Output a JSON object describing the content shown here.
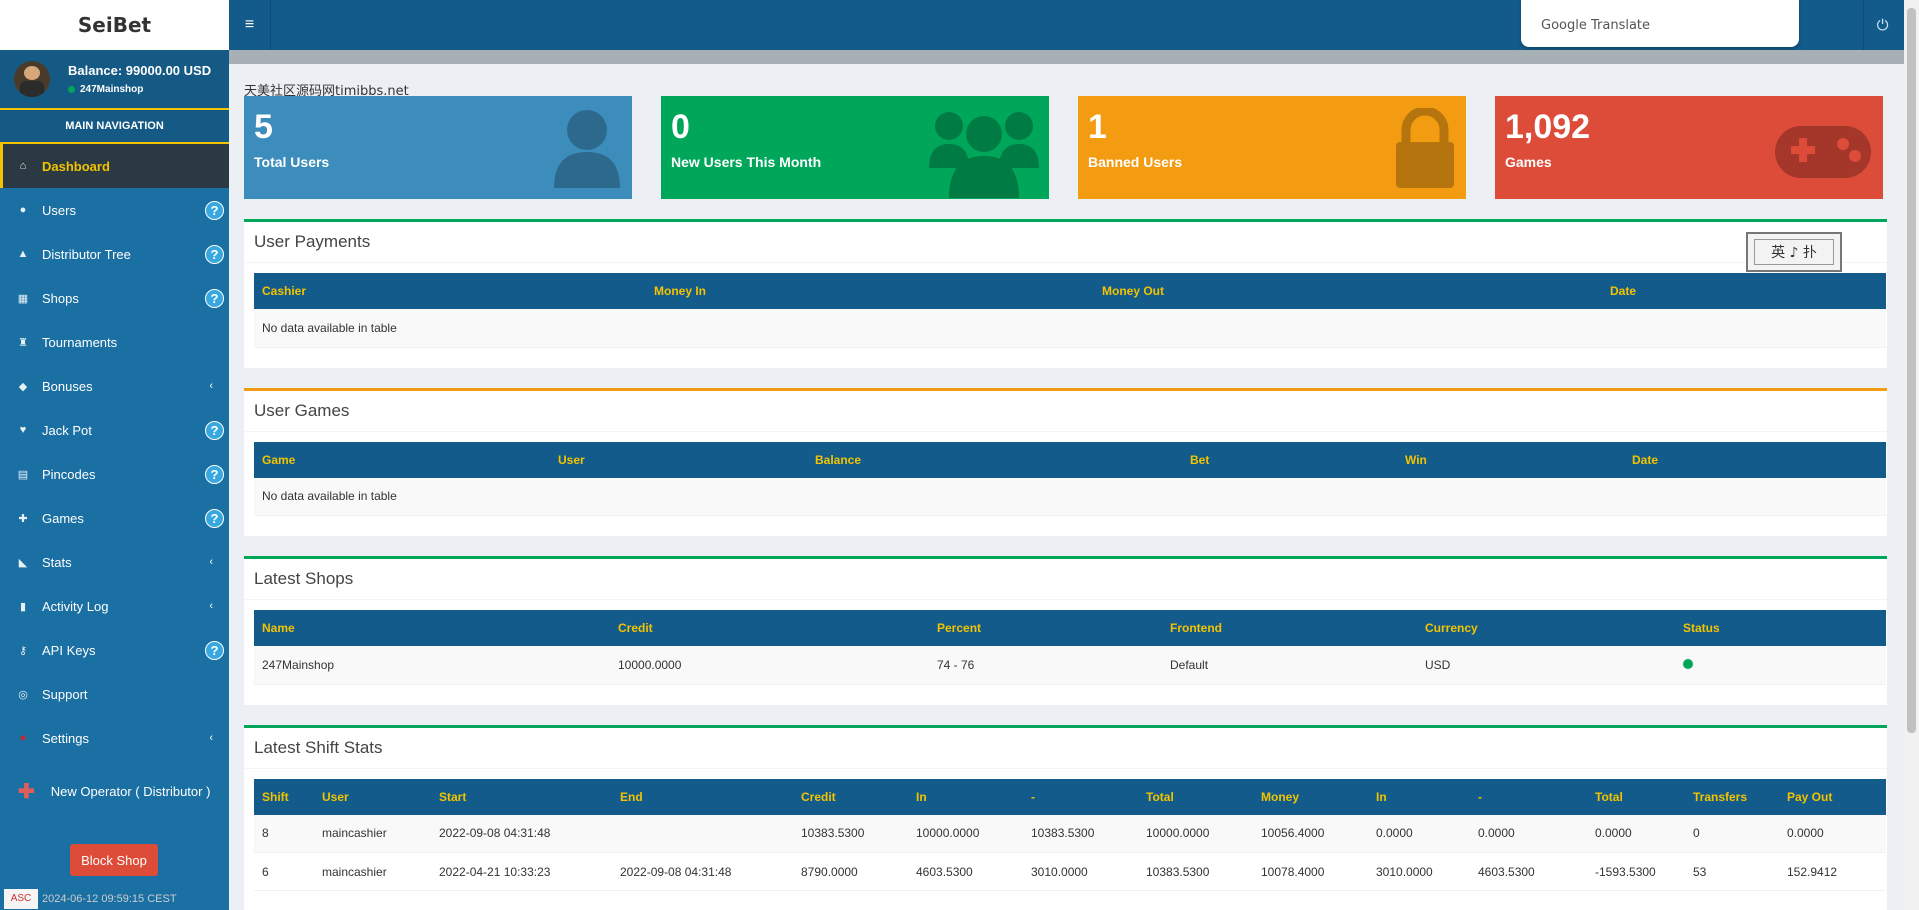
{
  "app": {
    "logo": "SeiBet"
  },
  "user": {
    "balance": "Balance: 99000.00 USD",
    "shop": "247Mainshop"
  },
  "nav": {
    "header": "MAIN NAVIGATION",
    "items": [
      {
        "label": "Dashboard",
        "icon": "home-icon",
        "glyph": "⌂"
      },
      {
        "label": "Users",
        "icon": "user-icon",
        "glyph": "●",
        "help": "?"
      },
      {
        "label": "Distributor Tree",
        "icon": "tree-icon",
        "glyph": "▲",
        "help": "?"
      },
      {
        "label": "Shops",
        "icon": "bank-icon",
        "glyph": "▦",
        "help": "?"
      },
      {
        "label": "Tournaments",
        "icon": "trophy-icon",
        "glyph": "♜"
      },
      {
        "label": "Bonuses",
        "icon": "diamond-icon",
        "glyph": "◆",
        "chevron": "‹"
      },
      {
        "label": "Jack Pot",
        "icon": "heartbeat-icon",
        "glyph": "♥",
        "help": "?"
      },
      {
        "label": "Pincodes",
        "icon": "grid-icon",
        "glyph": "▤",
        "help": "?"
      },
      {
        "label": "Games",
        "icon": "gamepad-icon",
        "glyph": "✚",
        "help": "?"
      },
      {
        "label": "Stats",
        "icon": "area-chart-icon",
        "glyph": "◣",
        "chevron": "‹"
      },
      {
        "label": "Activity Log",
        "icon": "bar-chart-icon",
        "glyph": "▮",
        "chevron": "‹"
      },
      {
        "label": "API Keys",
        "icon": "key-icon",
        "glyph": "⚷",
        "help": "?"
      },
      {
        "label": "Support",
        "icon": "life-ring-icon",
        "glyph": "◎"
      },
      {
        "label": "Settings",
        "icon": "settings-icon",
        "glyph": "●",
        "chevron": "‹"
      }
    ],
    "new_operator": "New Operator ( Distributor )",
    "block_shop": "Block Shop"
  },
  "footer": {
    "datetime": "2024-06-12 09:59:15 CEST",
    "badge": "ASC"
  },
  "header": {
    "menu_glyph": "≡",
    "power_glyph": "⏻",
    "translate": {
      "brand": "Google",
      "product": "Translate"
    }
  },
  "watermark": "天美社区源码网timibbs.net",
  "tiles": [
    {
      "value": "5",
      "label": "Total Users"
    },
    {
      "value": "0",
      "label": "New Users This Month"
    },
    {
      "value": "1",
      "label": "Banned Users"
    },
    {
      "value": "1,092",
      "label": "Games"
    }
  ],
  "user_payments": {
    "title": "User Payments",
    "columns": [
      "Cashier",
      "Money In",
      "Money Out",
      "Date"
    ],
    "empty": "No data available in table",
    "stamp": "英 ♪ 扑"
  },
  "user_games": {
    "title": "User Games",
    "columns": [
      "Game",
      "User",
      "Balance",
      "Bet",
      "Win",
      "Date"
    ],
    "empty": "No data available in table"
  },
  "latest_shops": {
    "title": "Latest Shops",
    "columns": [
      "Name",
      "Credit",
      "Percent",
      "Frontend",
      "Currency",
      "Status"
    ],
    "rows": [
      [
        "247Mainshop",
        "10000.0000",
        "74 - 76",
        "Default",
        "USD"
      ]
    ]
  },
  "shift_stats": {
    "title": "Latest Shift Stats",
    "columns": [
      "Shift",
      "User",
      "Start",
      "End",
      "Credit",
      "In",
      "-",
      "Total",
      "Money",
      "In",
      "-",
      "Total",
      "Transfers",
      "Pay Out"
    ],
    "rows": [
      [
        "8",
        "maincashier",
        "2022-09-08 04:31:48",
        "",
        "10383.5300",
        "10000.0000",
        "10383.5300",
        "10000.0000",
        "10056.4000",
        "0.0000",
        "0.0000",
        "0.0000",
        "0",
        "0.0000"
      ],
      [
        "6",
        "maincashier",
        "2022-04-21 10:33:23",
        "2022-09-08 04:31:48",
        "8790.0000",
        "4603.5300",
        "3010.0000",
        "10383.5300",
        "10078.4000",
        "3010.0000",
        "4603.5300",
        "-1593.5300",
        "53",
        "152.9412"
      ]
    ]
  }
}
